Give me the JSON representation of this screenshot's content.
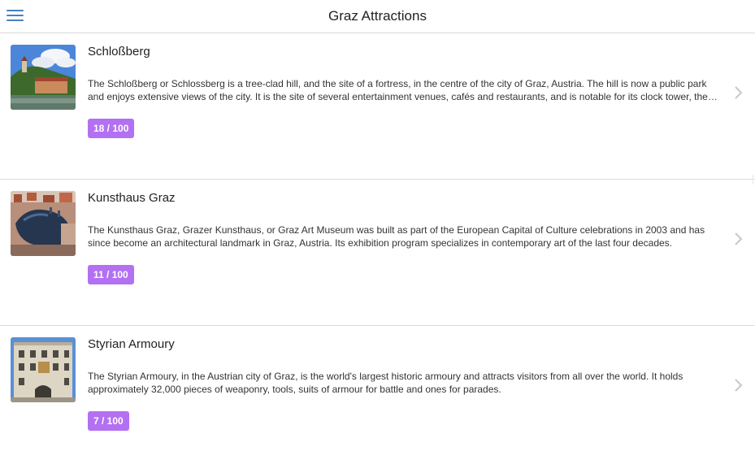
{
  "header": {
    "title": "Graz Attractions",
    "menu_icon": "hamburger-menu-icon"
  },
  "colors": {
    "accent": "#4a7fc1",
    "badge": "#b370f2",
    "divider": "#dcdcdc"
  },
  "items": [
    {
      "title": "Schloßberg",
      "description": "The Schloßberg or Schlossberg is a tree-clad hill, and the site of a fortress, in the centre of the city of Graz, Austria. The hill is now a public park and enjoys extensive views of the city. It is the site of several entertainment venues, cafés and restaurants, and is notable for its clock tower, the Uhrturm, a landmark of Graz.",
      "score": "18 / 100",
      "image": "schlossberg-photo",
      "chevron_icon": "chevron-right-icon"
    },
    {
      "title": "Kunsthaus Graz",
      "description": "The Kunsthaus Graz, Grazer Kunsthaus, or Graz Art Museum was built as part of the European Capital of Culture celebrations in 2003 and has since become an architectural landmark in Graz, Austria. Its exhibition program specializes in contemporary art of the last four decades.",
      "score": "11 / 100",
      "image": "kunsthaus-photo",
      "chevron_icon": "chevron-right-icon"
    },
    {
      "title": "Styrian Armoury",
      "description": "The Styrian Armoury, in the Austrian city of Graz, is the world's largest historic armoury and attracts visitors from all over the world. It holds approximately 32,000 pieces of weaponry, tools, suits of armour for battle and ones for parades.",
      "score": "7 / 100",
      "image": "armoury-photo",
      "chevron_icon": "chevron-right-icon"
    }
  ]
}
